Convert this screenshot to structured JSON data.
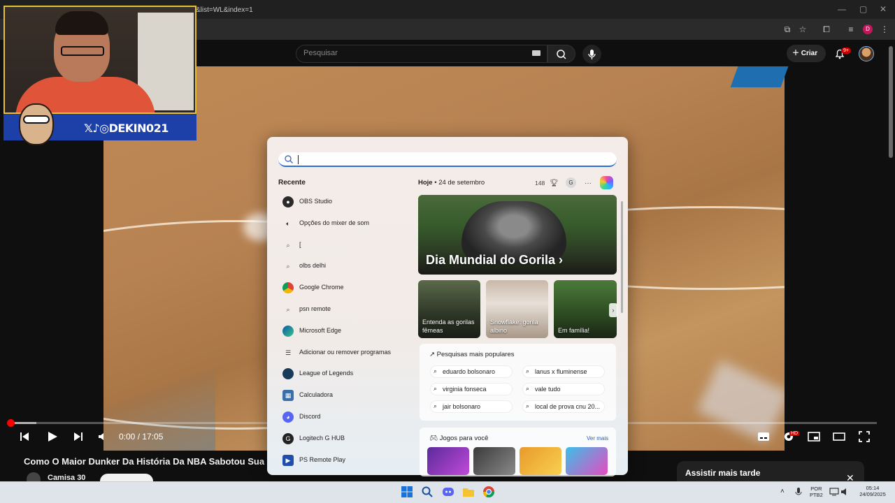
{
  "browser": {
    "url_fragment": "&list=WL&index=1",
    "profile_initial": "D"
  },
  "youtube": {
    "search_placeholder": "Pesquisar",
    "create_label": "Criar",
    "notif_count": "9+",
    "time_current": "0:00",
    "time_separator": " / ",
    "time_total": "17:05",
    "video_title": "Como O Maior Dunker Da História Da NBA Sabotou Sua Ca",
    "channel_name": "Camisa 30",
    "hd_badge": "HD",
    "watch_later_title": "Assistir mais tarde",
    "progress_fraction": 0.0
  },
  "webcam": {
    "banner_handle": "DEKIN021"
  },
  "start_panel": {
    "recent_heading": "Recente",
    "recent_items": [
      {
        "label": "OBS Studio",
        "icon": "obs-icon"
      },
      {
        "label": "Opções do mixer de som",
        "icon": "speaker-icon"
      },
      {
        "label": "[",
        "icon": "search-icon"
      },
      {
        "label": "olbs delhi",
        "icon": "search-icon"
      },
      {
        "label": "Google Chrome",
        "icon": "chrome-icon"
      },
      {
        "label": "psn remote",
        "icon": "search-icon"
      },
      {
        "label": "Microsoft Edge",
        "icon": "edge-icon"
      },
      {
        "label": "Adicionar ou remover programas",
        "icon": "settings-list-icon"
      },
      {
        "label": "League of Legends",
        "icon": "lol-icon"
      },
      {
        "label": "Calculadora",
        "icon": "calculator-icon"
      },
      {
        "label": "Discord",
        "icon": "discord-icon"
      },
      {
        "label": "Logitech G HUB",
        "icon": "logitech-icon"
      },
      {
        "label": "PS Remote Play",
        "icon": "ps-icon"
      }
    ],
    "today_label": "Hoje",
    "today_dot": "•",
    "today_date": "24 de setembro",
    "rewards_points": "148",
    "account_initial": "G",
    "more_label": "···",
    "hero_title": "Dia Mundial do Gorila",
    "hero_chevron": "›",
    "cards": [
      {
        "label": "Entenda as gorilas fêmeas"
      },
      {
        "label": "Snowflake: gorila albino"
      },
      {
        "label": "Em família!"
      }
    ],
    "popular_heading": "Pesquisas mais populares",
    "popular_searches": [
      "eduardo bolsonaro",
      "lanus x fluminense",
      "virginia fonseca",
      "vale tudo",
      "jair bolsonaro",
      "local de prova cnu 20..."
    ],
    "games_heading": "Jogos para você",
    "games_more": "Ver mais"
  },
  "taskbar": {
    "lang_top": "POR",
    "lang_bottom": "PTB2",
    "clock_time": "05:14",
    "clock_date": "24/09/2025"
  },
  "colors": {
    "accent_red": "#ff0000",
    "banner_blue": "#1d3fa8",
    "windows_accent": "#2b6fd0"
  }
}
